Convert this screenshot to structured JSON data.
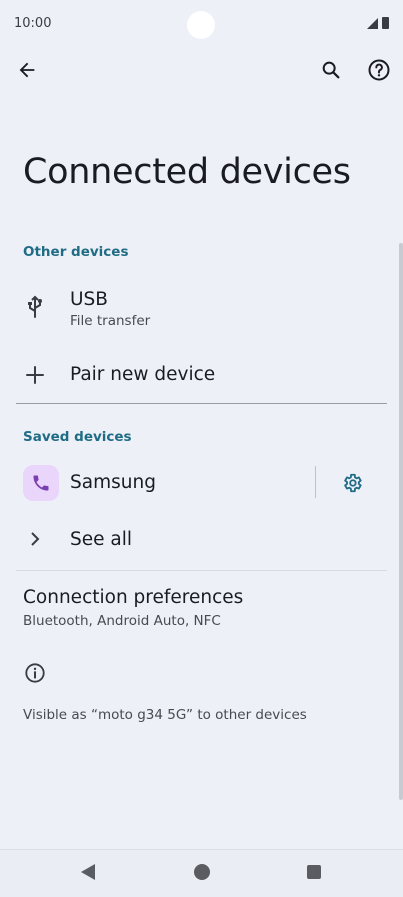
{
  "status": {
    "time": "10:00"
  },
  "toolbar": {
    "back_icon": "arrow-back-icon",
    "search_icon": "search-icon",
    "help_icon": "help-icon"
  },
  "title": "Connected devices",
  "other_devices": {
    "header": "Other devices",
    "usb": {
      "title": "USB",
      "subtitle": "File transfer",
      "icon": "usb-icon"
    },
    "pair": {
      "title": "Pair new device",
      "icon": "plus-icon"
    }
  },
  "saved_devices": {
    "header": "Saved devices",
    "samsung": {
      "title": "Samsung",
      "icon": "phone-icon",
      "settings_icon": "gear-icon"
    },
    "see_all": {
      "title": "See all",
      "icon": "chevron-right-icon"
    }
  },
  "connection_preferences": {
    "title": "Connection preferences",
    "subtitle": "Bluetooth, Android Auto, NFC"
  },
  "footer": {
    "info_icon": "info-icon",
    "visible_text": "Visible as “moto g34 5G” to other devices"
  },
  "colors": {
    "background": "#eef0f8",
    "accent": "#1f6c84",
    "avatar_bg": "#ead5fb",
    "avatar_icon": "#7a3fb0"
  }
}
